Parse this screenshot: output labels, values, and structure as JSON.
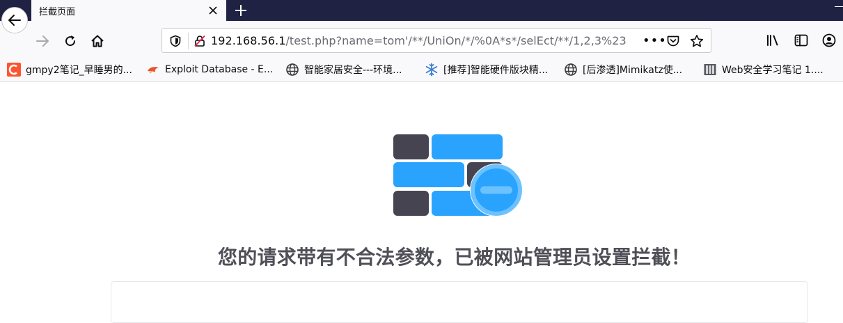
{
  "browser": {
    "tab": {
      "title": "拦截页面",
      "close_icon": "close-icon"
    },
    "new_tab_icon": "plus-icon",
    "url": {
      "host": "192.168.56.1",
      "path": "/test.php?name=tom'/**/UniOn/*/%0A*s*/selEct/**/1,2,3%23",
      "overflow_dots": "•••"
    },
    "bookmarks": [
      {
        "label": "gmpy2笔记_早睡男的...",
        "icon": "csdn-icon",
        "color": "#fc5531"
      },
      {
        "label": "Exploit Database - E...",
        "icon": "exploit-db-icon",
        "color": "#e8542c"
      },
      {
        "label": "智能家居安全---环境...",
        "icon": "globe-icon"
      },
      {
        "label": "[推荐]智能硬件版块精...",
        "icon": "snowflake-icon",
        "color": "#3b7fd1"
      },
      {
        "label": "[后渗透]Mimikatz使...",
        "icon": "globe-icon"
      },
      {
        "label": "Web安全学习笔记 1....",
        "icon": "book-icon"
      }
    ]
  },
  "page": {
    "illustration": "blocked-firewall-icon",
    "headline": "您的请求带有不合法参数，已被网站管理员设置拦截！",
    "colors": {
      "brick_dark": "#474452",
      "brick_blue": "#2aa3ff",
      "ring": "#6cc2ff"
    }
  }
}
